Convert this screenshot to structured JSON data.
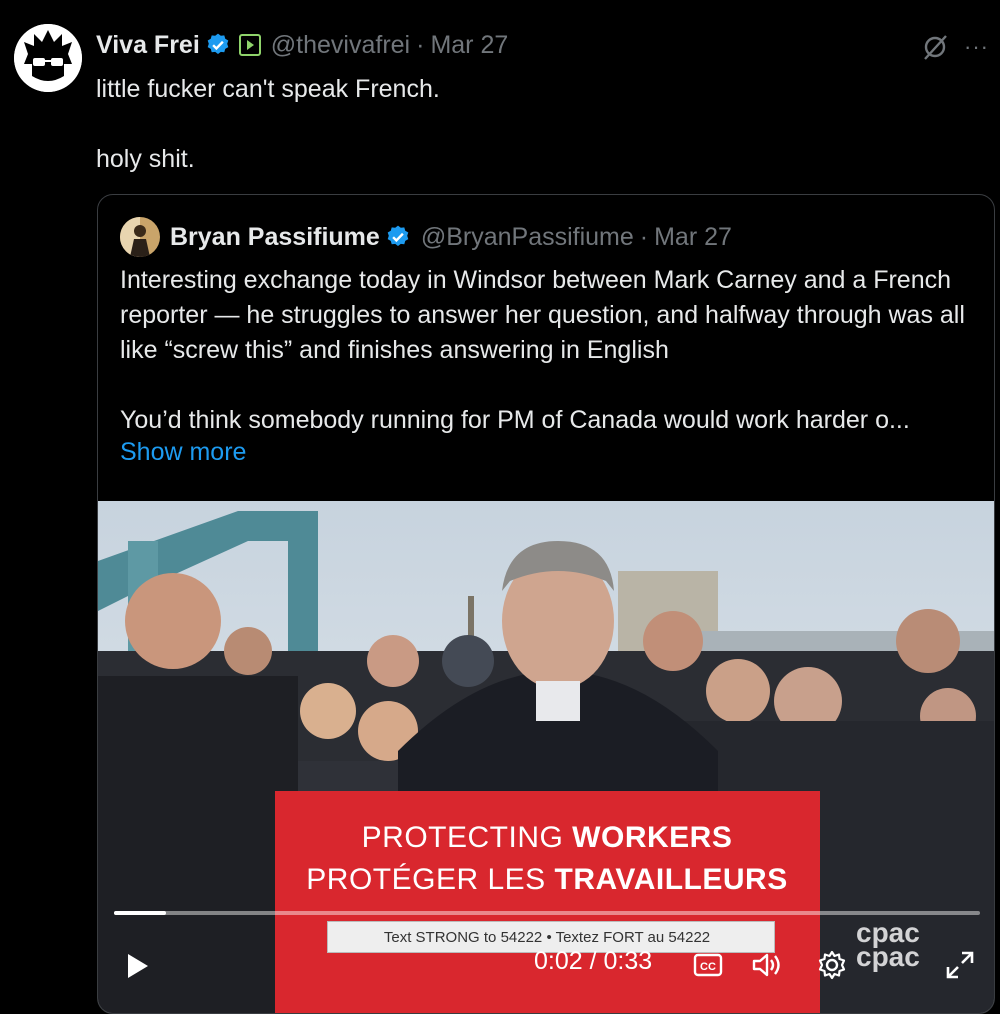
{
  "tweet": {
    "author_name": "Viva Frei",
    "handle": "@thevivafrei",
    "separator": "·",
    "date": "Mar 27",
    "text": "little fucker can't speak French.\n\nholy shit.",
    "more_label": "···"
  },
  "quote": {
    "author_name": "Bryan Passifiume",
    "handle": "@BryanPassifiume",
    "separator": "·",
    "date": "Mar 27",
    "text": "Interesting exchange today in Windsor between Mark Carney and a French reporter — he struggles to answer her question, and halfway through was all like “screw this” and finishes answering in English\n\nYou’d think somebody running for PM of Canada would work harder o...",
    "show_more": "Show more"
  },
  "video": {
    "sign_line1_a": "PROTECTING ",
    "sign_line1_b": "WORKERS",
    "sign_line2_a": "PROTÉGER LES ",
    "sign_line2_b": "TRAVAILLEURS",
    "sign_line3": "Text STRONG to 54222 • Textez FORT au 54222",
    "watermark_1": "cpac",
    "watermark_2": "cpac",
    "time_display": "0:02 / 0:33",
    "progress": 0.06
  },
  "colors": {
    "accent": "#1d9bf0",
    "verified": "#1d9bf0",
    "sign_red": "#d9272e"
  }
}
